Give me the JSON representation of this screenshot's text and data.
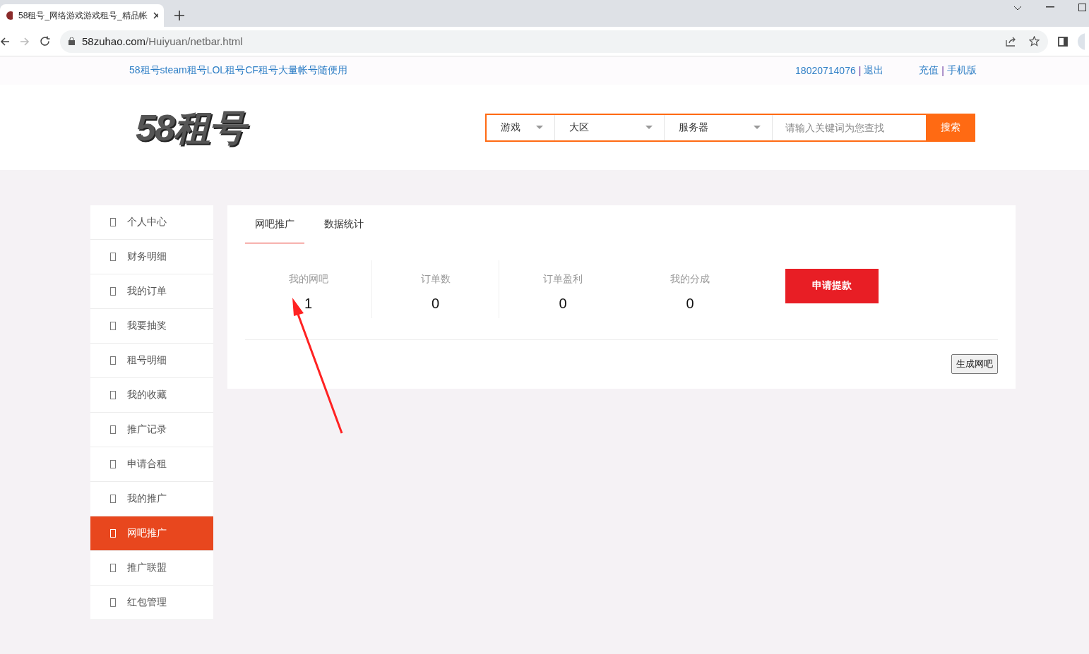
{
  "browser": {
    "tab_title": "58租号_网络游戏游戏租号_精品帐",
    "url_host": "58zuhao.com",
    "url_path": "/Huiyuan/netbar.html"
  },
  "top_bar": {
    "slogan": "58租号steam租号LOL租号CF租号大量帐号随便用",
    "phone": "18020714076",
    "separator_1": "|",
    "logout": "退出",
    "recharge": "充值",
    "separator_2": "|",
    "mobile": "手机版"
  },
  "header": {
    "logo": "58租号",
    "search": {
      "selects": [
        "游戏",
        "大区",
        "服务器"
      ],
      "placeholder": "请输入关键词为您查找",
      "button": "搜索"
    }
  },
  "sidebar": {
    "items": [
      {
        "label": "个人中心",
        "selected": false
      },
      {
        "label": "财务明细",
        "selected": false
      },
      {
        "label": "我的订单",
        "selected": false
      },
      {
        "label": "我要抽奖",
        "selected": false
      },
      {
        "label": "租号明细",
        "selected": false
      },
      {
        "label": "我的收藏",
        "selected": false
      },
      {
        "label": "推广记录",
        "selected": false
      },
      {
        "label": "申请合租",
        "selected": false
      },
      {
        "label": "我的推广",
        "selected": false
      },
      {
        "label": "网吧推广",
        "selected": true
      },
      {
        "label": "推广联盟",
        "selected": false
      },
      {
        "label": "红包管理",
        "selected": false
      }
    ]
  },
  "content": {
    "tabs": [
      {
        "label": "网吧推广",
        "selected": true
      },
      {
        "label": "数据统计",
        "selected": false
      }
    ],
    "stats": [
      {
        "label": "我的网吧",
        "value": "1"
      },
      {
        "label": "订单数",
        "value": "0"
      },
      {
        "label": "订单盈利",
        "value": "0"
      },
      {
        "label": "我的分成",
        "value": "0"
      }
    ],
    "withdraw_button": "申请提款",
    "generate_button": "生成网吧"
  }
}
